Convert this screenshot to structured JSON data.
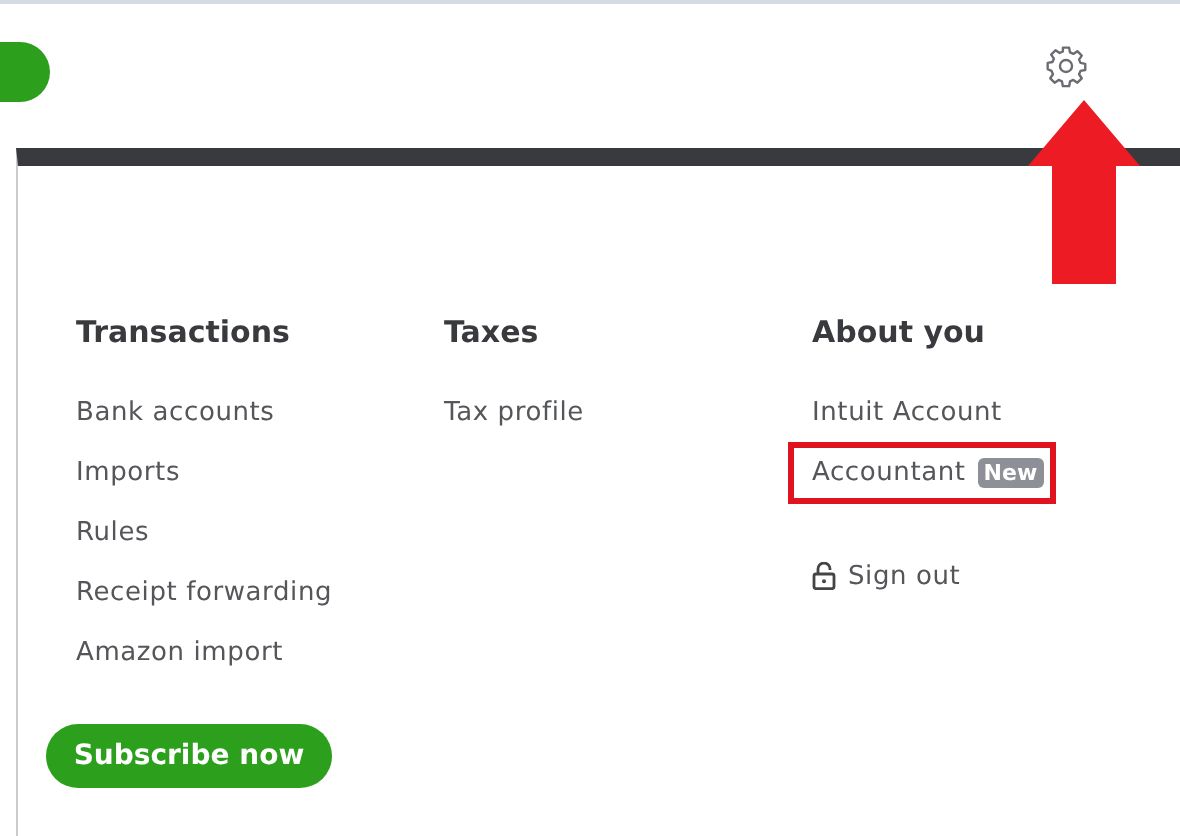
{
  "menu": {
    "columns": [
      {
        "heading": "Transactions",
        "items": [
          {
            "label": "Bank accounts",
            "kind": "link",
            "highlighted": false
          },
          {
            "label": "Imports",
            "kind": "link",
            "highlighted": false
          },
          {
            "label": "Rules",
            "kind": "link",
            "highlighted": false
          },
          {
            "label": "Receipt forwarding",
            "kind": "link",
            "highlighted": false
          },
          {
            "label": "Amazon import",
            "kind": "link",
            "highlighted": false
          }
        ]
      },
      {
        "heading": "Taxes",
        "items": [
          {
            "label": "Tax profile",
            "kind": "link",
            "highlighted": false
          }
        ]
      },
      {
        "heading": "About you",
        "items": [
          {
            "label": "Intuit Account",
            "kind": "link",
            "highlighted": false
          },
          {
            "label": "Accountant",
            "kind": "badge",
            "badge": "New",
            "highlighted": true
          },
          {
            "label": "Sign out",
            "kind": "signout",
            "highlighted": false
          }
        ]
      }
    ],
    "subscribe_button": "Subscribe now"
  }
}
